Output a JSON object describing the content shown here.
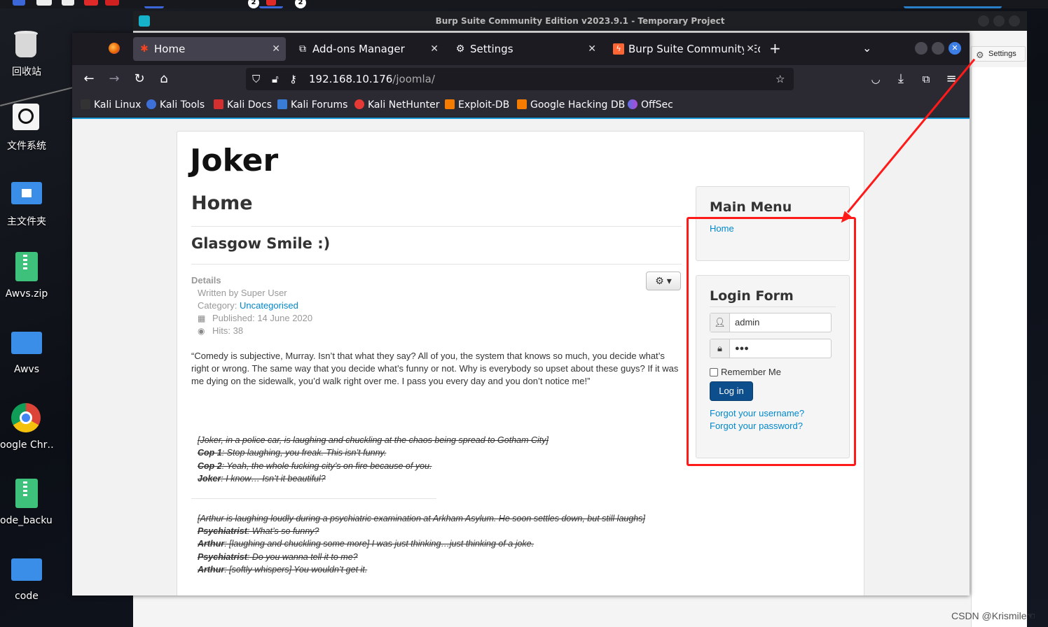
{
  "desktop": {
    "icons": [
      {
        "label": "回收站",
        "icon": "trash-icon"
      },
      {
        "label": "文件系统",
        "icon": "disk-icon"
      },
      {
        "label": "主文件夹",
        "icon": "home-folder-icon"
      },
      {
        "label": "Awvs.zip",
        "icon": "zip-icon"
      },
      {
        "label": "Awvs",
        "icon": "folder-icon"
      },
      {
        "label": "oogle Chr…",
        "icon": "chrome-icon"
      },
      {
        "label": "ode_backu…",
        "icon": "zip-link-icon"
      },
      {
        "label": "code",
        "icon": "folder-icon"
      }
    ],
    "taskbar_badges": [
      "2",
      "2"
    ],
    "watermark": "CSDN @Krismile☜"
  },
  "burp": {
    "title": "Burp Suite Community Edition v2023.9.1 - Temporary Project",
    "settings_label": "Settings"
  },
  "firefox": {
    "tabs": [
      {
        "label": "Home",
        "icon": "joomla-icon",
        "active": true
      },
      {
        "label": "Add-ons Manager",
        "icon": "puzzle-icon"
      },
      {
        "label": "Settings",
        "icon": "gear-icon"
      },
      {
        "label": "Burp Suite Community Ed",
        "icon": "burp-icon"
      }
    ],
    "url_host": "192.168.10.176",
    "url_path": "/joomla/",
    "bookmarks": [
      "Kali Linux",
      "Kali Tools",
      "Kali Docs",
      "Kali Forums",
      "Kali NetHunter",
      "Exploit-DB",
      "Google Hacking DB",
      "OffSec"
    ]
  },
  "page": {
    "site_title": "Joker",
    "heading": "Home",
    "article_title": "Glasgow Smile :)",
    "details_label": "Details",
    "written_by": "Written by Super User",
    "category_label": "Category: ",
    "category_link": "Uncategorised",
    "published": "Published: 14 June 2020",
    "hits": "Hits: 38",
    "quote": "“Comedy is subjective, Murray. Isn’t that what they say? All of you, the system that knows so much, you decide what’s right or wrong. The same way that you decide what’s funny or not. Why is everybody so upset about these guys? If it was me dying on the sidewalk, you’d walk right over me. I pass you every day and you don’t notice me!”",
    "dialogue1": [
      {
        "speaker": "",
        "text": "[Joker, in a police car, is laughing and chuckling at the chaos being spread to Gotham City]"
      },
      {
        "speaker": "Cop 1",
        "text": ": Stop laughing, you freak. This isn’t funny."
      },
      {
        "speaker": "Cop 2",
        "text": ": Yeah, the whole fucking city’s on fire because of you."
      },
      {
        "speaker": "Joker",
        "text": ": I know… Isn’t it beautiful?"
      }
    ],
    "dialogue2": [
      {
        "speaker": "",
        "text": "[Arthur is laughing loudly during a psychiatric examination at Arkham Asylum. He soon settles down, but still laughs]"
      },
      {
        "speaker": "Psychiatrist",
        "text": ": What’s so funny?"
      },
      {
        "speaker": "Arthur",
        "text": ": [laughing and chuckling some more] I was just thinking…just thinking of a joke."
      },
      {
        "speaker": "Psychiatrist",
        "text": ": Do you wanna tell it to me?"
      },
      {
        "speaker": "Arthur",
        "text": ": [softly whispers] You wouldn’t get it."
      }
    ]
  },
  "sidebar": {
    "main_menu_title": "Main Menu",
    "main_menu_item": "Home",
    "login_title": "Login Form",
    "username_value": "admin",
    "password_value": "●●●",
    "remember_label": "Remember Me",
    "login_button": "Log in",
    "forgot_username": "Forgot your username?",
    "forgot_password": "Forgot your password?"
  },
  "colors": {
    "annotation": "#ff1a1a",
    "link": "#0088cc",
    "login_button": "#0d4f8c"
  }
}
